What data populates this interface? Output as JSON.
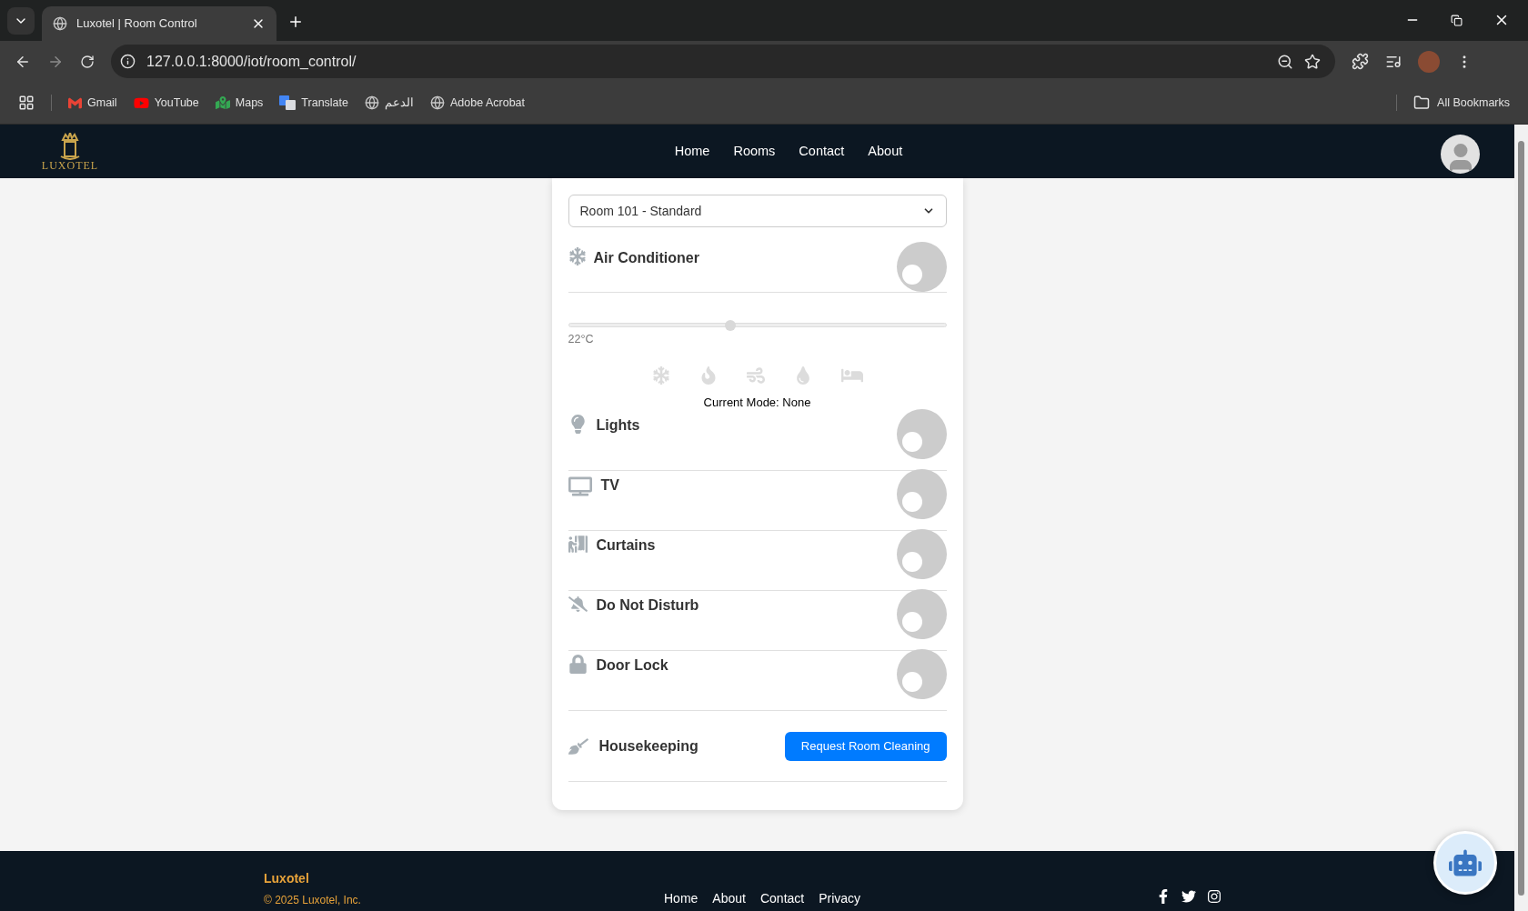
{
  "browser": {
    "tabs": [
      {
        "title": "Luxotel | Room Control",
        "selected": true
      }
    ],
    "url": "127.0.0.1:8000/iot/room_control/",
    "bookmarks": [
      {
        "label": "Gmail",
        "kind": "gmail"
      },
      {
        "label": "YouTube",
        "kind": "youtube"
      },
      {
        "label": "Maps",
        "kind": "maps"
      },
      {
        "label": "Translate",
        "kind": "translate"
      },
      {
        "label": "الدعم",
        "kind": "globe"
      },
      {
        "label": "Adobe Acrobat",
        "kind": "globe"
      }
    ],
    "all_bookmarks": "All Bookmarks"
  },
  "header": {
    "logo_text": "LUXOTEL",
    "nav": [
      "Home",
      "Rooms",
      "Contact",
      "About"
    ]
  },
  "room_select": {
    "value": "Room 101 - Standard"
  },
  "air_conditioner": {
    "label": "Air Conditioner",
    "on": false,
    "level": 0.43,
    "reading": "22°C",
    "modes": [
      {
        "kind": "cool",
        "selected": false
      },
      {
        "kind": "heat",
        "selected": false
      },
      {
        "kind": "fan",
        "selected": false
      },
      {
        "kind": "dry",
        "selected": false
      },
      {
        "kind": "sleep",
        "selected": false
      }
    ],
    "current_mode": "Current Mode: None"
  },
  "devices": [
    {
      "kind": "lights",
      "label": "Lights",
      "on": false
    },
    {
      "kind": "tv",
      "label": "TV",
      "on": false
    },
    {
      "kind": "curtains",
      "label": "Curtains",
      "on": false
    },
    {
      "kind": "dnd",
      "label": "Do Not Disturb",
      "on": false
    },
    {
      "kind": "lock",
      "label": "Door Lock",
      "on": false
    }
  ],
  "housekeeping": {
    "label": "Housekeeping",
    "button": "Request Room Cleaning"
  },
  "footer": {
    "brand": "Luxotel",
    "copyright": "© 2025 Luxotel, Inc.",
    "links": [
      "Home",
      "About",
      "Contact",
      "Privacy"
    ],
    "socials": [
      {
        "kind": "facebook"
      },
      {
        "kind": "twitter"
      },
      {
        "kind": "instagram"
      }
    ]
  }
}
